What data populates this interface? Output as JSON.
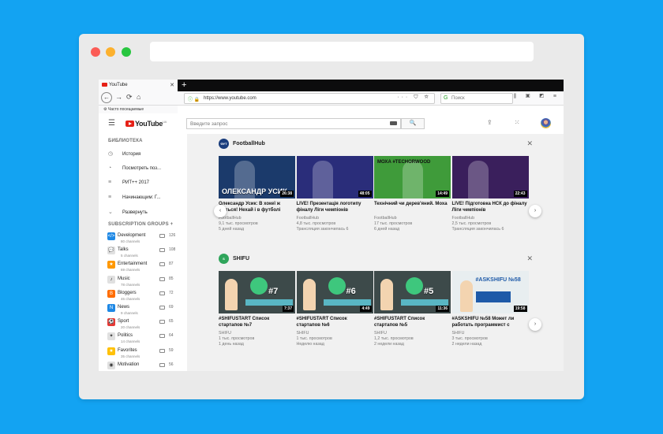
{
  "browser": {
    "tab_title": "YouTube",
    "tab_close": "✕",
    "new_tab": "+",
    "url": "https://www.youtube.com",
    "url_icons": "ⓘ 🔒",
    "url_actions": "··· ⛉ ☆",
    "search_placeholder": "Поиск",
    "search_engine_icon": "G",
    "toolbar_icons": "⫼ ▣ ◩ ≡",
    "bookmark": "Часто посещаемые",
    "back": "←",
    "forward": "→",
    "reload": "⟳",
    "home": "⌂"
  },
  "youtube": {
    "logo": "YouTube",
    "region": "UA",
    "search_placeholder": "Введите запрос",
    "search_button": "🔍",
    "header_icons": "⇪ ⁙ 🔔",
    "menu_icon": "☰"
  },
  "sidebar": {
    "library_heading": "БИБЛИОТЕКА",
    "library": [
      {
        "icon": "◷",
        "label": "История"
      },
      {
        "icon": "◔",
        "label": "Посмотреть поз..."
      },
      {
        "icon": "≡",
        "label": "РИТ++ 2017"
      },
      {
        "icon": "≡",
        "label": "Начинающим: Г..."
      },
      {
        "icon": "⌄",
        "label": "Развернуть"
      }
    ],
    "subs_heading": "SUBSCRIPTION GROUPS +",
    "groups": [
      {
        "name": "Development",
        "channels": "80 channels",
        "count": "126",
        "icon": "</>",
        "color": "#1e88e5"
      },
      {
        "name": "Talks",
        "channels": "5 channels",
        "count": "108",
        "icon": "💬",
        "color": "#e0e0e0"
      },
      {
        "name": "Entertainment",
        "channels": "69 channels",
        "count": "87",
        "icon": "★",
        "color": "#ff9800"
      },
      {
        "name": "Music",
        "channels": "78 channels",
        "count": "85",
        "icon": "♪",
        "color": "#e0e0e0"
      },
      {
        "name": "Bloggers",
        "channels": "46 channels",
        "count": "72",
        "icon": "B",
        "color": "#ff6d00"
      },
      {
        "name": "News",
        "channels": "9 channels",
        "count": "69",
        "icon": "N",
        "color": "#1e88e5"
      },
      {
        "name": "Sport",
        "channels": "20 channels",
        "count": "65",
        "icon": "⚽",
        "color": "#e53935"
      },
      {
        "name": "Politics",
        "channels": "14 channels",
        "count": "64",
        "icon": "✦",
        "color": "#e0e0e0"
      },
      {
        "name": "Favorites",
        "channels": "35 channels",
        "count": "59",
        "icon": "★",
        "color": "#ffc107"
      },
      {
        "name": "Motivation",
        "channels": "",
        "count": "56",
        "icon": "◉",
        "color": "#e0e0e0"
      }
    ]
  },
  "shelves": [
    {
      "channel": "FootballHub",
      "channel_icon": "ФУТ",
      "close": "✕",
      "videos": [
        {
          "title": "Олександр Усик: В хокеї ж бються! Нехай і в футболі",
          "channel": "FootballHub",
          "views": "9,1 тыс. просмотров",
          "age": "5 дней назад",
          "duration": "26:38",
          "overlay": "ОЛЕКСАНДР УСИК",
          "bg": "#1b3a6b"
        },
        {
          "title": "LIVE! Презентація логотипу фіналу Ліги чемпіонів",
          "channel": "FootballHub",
          "views": "4,8 тыс. просмотров",
          "age": "Трансляция закончилась 6",
          "duration": "48:05",
          "overlay": "",
          "bg": "#2a2d7a"
        },
        {
          "title": "Технічний чи дерев'яний. Моха",
          "channel": "FootballHub",
          "views": "17 тыс. просмотров",
          "age": "6 дней назад",
          "duration": "14:49",
          "overlay": "МОХА #TECHORWOOD",
          "bg": "#3f9b3a"
        },
        {
          "title": "LIVE! Підготовка НСК до фіналу Ліги чемпіонів",
          "channel": "FootballHub",
          "views": "2,5 тыс. просмотров",
          "age": "Трансляция закончилась 6",
          "duration": "22:43",
          "overlay": "",
          "bg": "#3a1f5c"
        }
      ]
    },
    {
      "channel": "SHIFU",
      "channel_icon": "S",
      "close": "✕",
      "videos": [
        {
          "title": "#SHIFUSTART Список стартапов №7",
          "channel": "SHIFU",
          "views": "1 тыс. просмотров",
          "age": "1 день назад",
          "duration": "7:37",
          "overlay": "#7",
          "bg": "#3d4a4a"
        },
        {
          "title": "#SHIFUSTART Список стартапов №6",
          "channel": "SHIFU",
          "views": "1 тыс. просмотров",
          "age": "Неделю назад",
          "duration": "4:49",
          "overlay": "#6",
          "bg": "#3d4a4a"
        },
        {
          "title": "#SHIFUSTART Список стартапов №5",
          "channel": "SHIFU",
          "views": "1,2 тыс. просмотров",
          "age": "2 недели назад",
          "duration": "11:36",
          "overlay": "#5",
          "bg": "#3d4a4a"
        },
        {
          "title": "#ASKSHIFU №58 Может ли работать программист с",
          "channel": "SHIFU",
          "views": "3 тыс. просмотров",
          "age": "2 недели назад",
          "duration": "19:58",
          "overlay": "#ASKSHIFU №58",
          "bg": "#e8eef0"
        }
      ]
    }
  ],
  "arrows": {
    "left": "‹",
    "right": "›"
  }
}
